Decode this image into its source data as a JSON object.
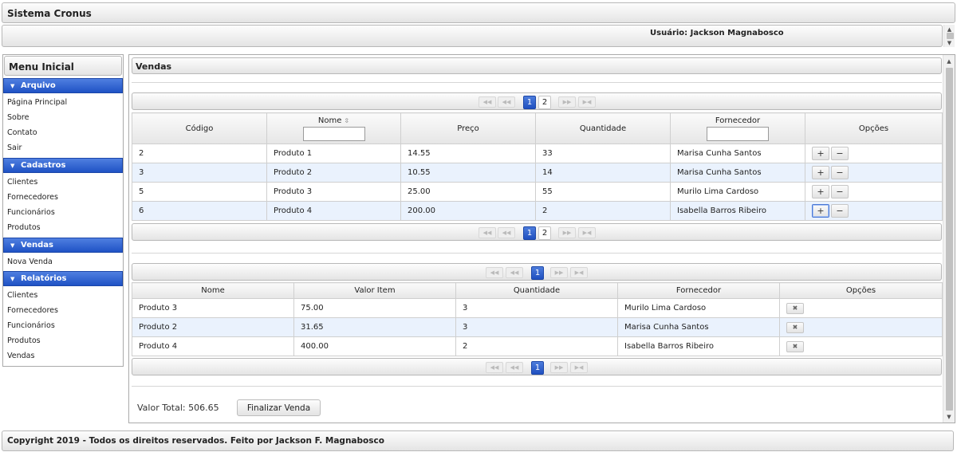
{
  "header": {
    "title": "Sistema Cronus",
    "user": "Usuário: Jackson Magnabosco"
  },
  "sidebar": {
    "title": "Menu Inicial",
    "groups": [
      {
        "label": "Arquivo",
        "items": [
          "Página Principal",
          "Sobre",
          "Contato",
          "Sair"
        ]
      },
      {
        "label": "Cadastros",
        "items": [
          "Clientes",
          "Fornecedores",
          "Funcionários",
          "Produtos"
        ]
      },
      {
        "label": "Vendas",
        "items": [
          "Nova Venda"
        ]
      },
      {
        "label": "Relatórios",
        "items": [
          "Clientes",
          "Fornecedores",
          "Funcionários",
          "Produtos",
          "Vendas"
        ]
      }
    ]
  },
  "main": {
    "title": "Vendas",
    "products_table": {
      "paginator": {
        "pages": [
          "1",
          "2"
        ],
        "current": "1",
        "first": "◀◀",
        "prev": "◀◀",
        "next": "▶▶",
        "last": "▶◀"
      },
      "columns": [
        "Código",
        "Nome",
        "Preço",
        "Quantidade",
        "Fornecedor",
        "Opções"
      ],
      "sort_icon": "sort-icon",
      "rows": [
        {
          "codigo": "2",
          "nome": "Produto 1",
          "preco": "14.55",
          "quantidade": "33",
          "fornecedor": "Marisa Cunha Santos"
        },
        {
          "codigo": "3",
          "nome": "Produto 2",
          "preco": "10.55",
          "quantidade": "14",
          "fornecedor": "Marisa Cunha Santos"
        },
        {
          "codigo": "5",
          "nome": "Produto 3",
          "preco": "25.00",
          "quantidade": "55",
          "fornecedor": "Murilo Lima Cardoso"
        },
        {
          "codigo": "6",
          "nome": "Produto 4",
          "preco": "200.00",
          "quantidade": "2",
          "fornecedor": "Isabella Barros Ribeiro"
        }
      ],
      "add_label": "+",
      "remove_label": "−"
    },
    "cart_table": {
      "paginator": {
        "pages": [
          "1"
        ],
        "current": "1"
      },
      "columns": [
        "Nome",
        "Valor Item",
        "Quantidade",
        "Fornecedor",
        "Opções"
      ],
      "rows": [
        {
          "nome": "Produto 3",
          "valor": "75.00",
          "quantidade": "3",
          "fornecedor": "Murilo Lima Cardoso"
        },
        {
          "nome": "Produto 2",
          "valor": "31.65",
          "quantidade": "3",
          "fornecedor": "Marisa Cunha Santos"
        },
        {
          "nome": "Produto 4",
          "valor": "400.00",
          "quantidade": "2",
          "fornecedor": "Isabella Barros Ribeiro"
        }
      ],
      "delete_label": "✖"
    },
    "total_label": "Valor Total:",
    "total_value": "506.65",
    "finalize_label": "Finalizar Venda"
  },
  "footer": {
    "text": "Copyright 2019 - Todos os direitos reservados. Feito por Jackson F. Magnabosco"
  },
  "colors": {
    "accent": "#2556c8",
    "row_alt": "#eaf2fd"
  }
}
